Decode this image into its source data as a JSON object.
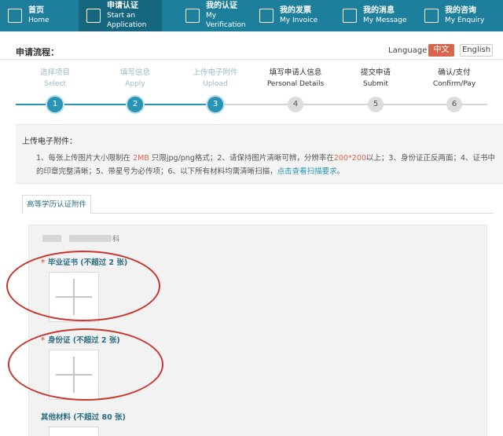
{
  "nav": [
    {
      "zh": "首页",
      "en": "Home",
      "icon": "home-icon",
      "active": false
    },
    {
      "zh": "申请认证",
      "en": "Start an Application",
      "icon": "checkbox-icon",
      "active": true
    },
    {
      "zh": "我的认证",
      "en": "My Verification",
      "icon": "certificate-icon",
      "active": false
    },
    {
      "zh": "我的发票",
      "en": "My Invoice",
      "icon": "invoice-icon",
      "active": false
    },
    {
      "zh": "我的消息",
      "en": "My Message",
      "icon": "message-icon",
      "active": false
    },
    {
      "zh": "我的咨询",
      "en": "My Enquiry",
      "icon": "enquiry-icon",
      "active": false
    }
  ],
  "header": {
    "title": "申请流程：",
    "language_label": "Language :",
    "lang_zh": "中文",
    "lang_en": "English"
  },
  "steps": [
    {
      "zh": "选择项目",
      "en": "Select",
      "num": "1",
      "state": "done"
    },
    {
      "zh": "填写信息",
      "en": "Apply",
      "num": "2",
      "state": "done"
    },
    {
      "zh": "上传电子附件",
      "en": "Upload",
      "num": "3",
      "state": "done"
    },
    {
      "zh": "填写申请人信息",
      "en": "Personal Details",
      "num": "4",
      "state": "todo"
    },
    {
      "zh": "提交申请",
      "en": "Submit",
      "num": "5",
      "state": "todo"
    },
    {
      "zh": "确认/支付",
      "en": "Confirm/Pay",
      "num": "6",
      "state": "todo"
    }
  ],
  "notice": {
    "title": "上传电子附件：",
    "p1": "1、每张上传图片大小限制在",
    "size": "2MB",
    "p2": "只限jpg/png格式；2、请保持图片清晰可辨，分辨率在",
    "res": "200*200",
    "p3": "以上；3、身份证正反两面；4、证书中的印章完整清晰；5、带星号为必传项；6、以下所有材料均需清晰扫描，",
    "link": "点击查看扫描要求",
    "p4": "。"
  },
  "tab": {
    "label": "高等学历认证附件"
  },
  "upload": {
    "blur_tail": "科",
    "fields": [
      {
        "required": true,
        "label": "毕业证书 (不超过 2 张)"
      },
      {
        "required": true,
        "label": "身份证 (不超过 2 张)"
      },
      {
        "required": false,
        "label": "其他材料 (不超过 80 张)"
      }
    ]
  },
  "colors": {
    "nav_bg": "#1e7f9d",
    "accent": "#2a94b5",
    "highlight": "#d9664c",
    "annotation": "#c9362f"
  }
}
